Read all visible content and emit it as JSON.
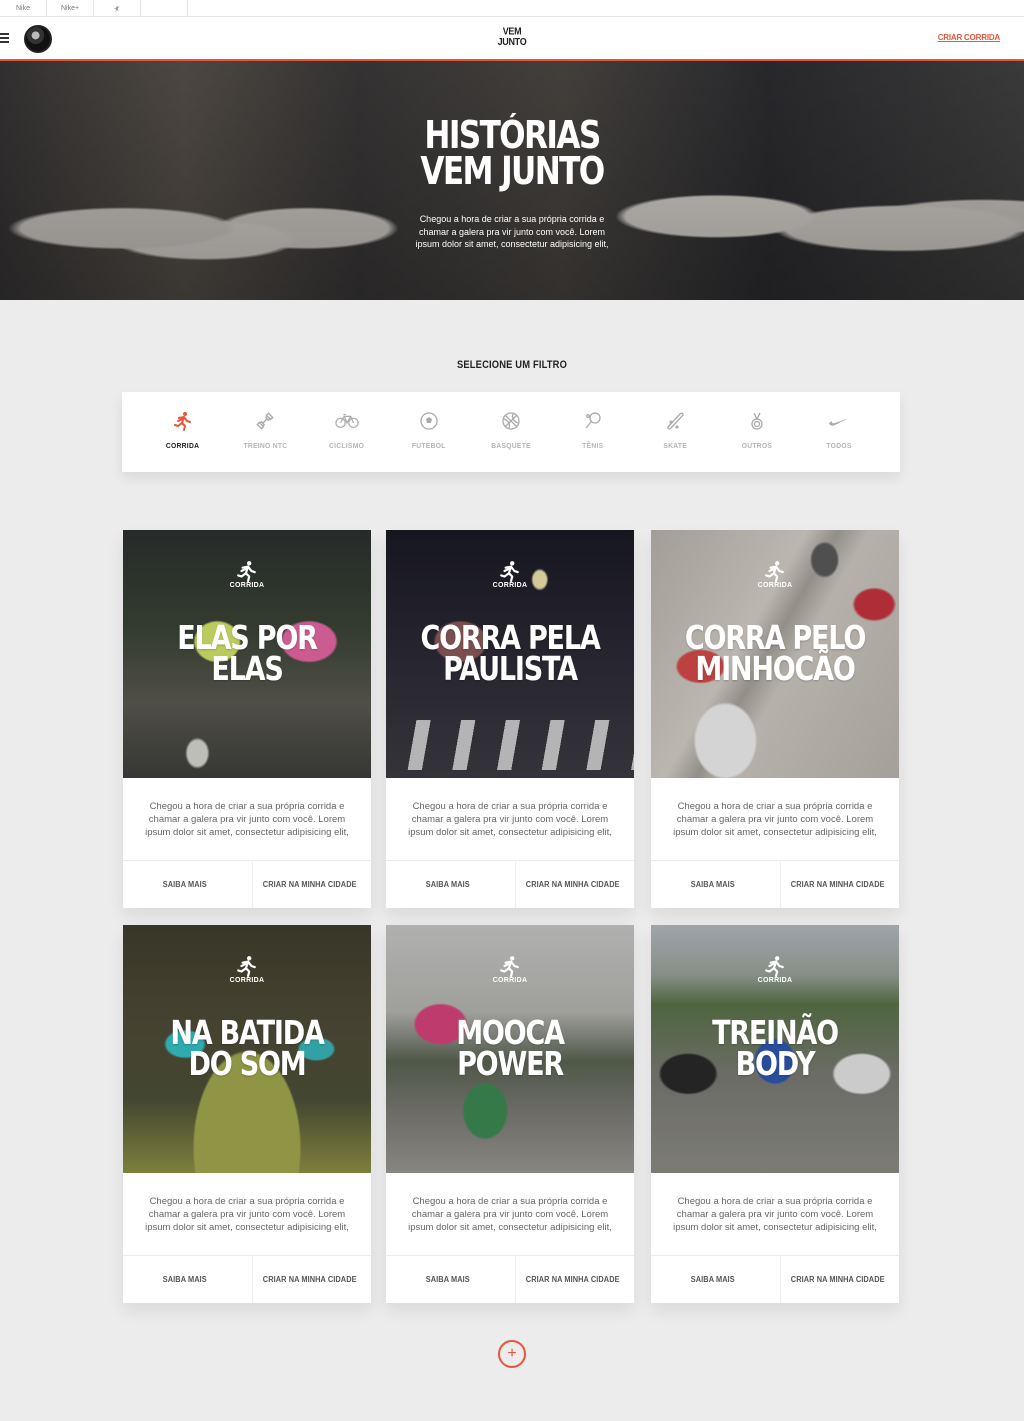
{
  "topbar": {
    "items": [
      "Nike",
      "Nike+",
      "Jordan"
    ]
  },
  "header": {
    "logo_line1": "VEM",
    "logo_line2": "JUNTO",
    "cta": "CRIAR CORRIDA"
  },
  "hero": {
    "title_line1": "HISTÓRIAS",
    "title_line2": "VEM JUNTO",
    "description": "Chegou a hora de criar a sua própria corrida e chamar a galera pra vir junto com você. Lorem ipsum dolor sit amet, consectetur adipisicing elit,"
  },
  "filter": {
    "heading": "SELECIONE UM FILTRO",
    "items": [
      {
        "label": "CORRIDA",
        "icon": "runner-icon",
        "active": true
      },
      {
        "label": "TREINO NTC",
        "icon": "dumbbell-icon",
        "active": false
      },
      {
        "label": "CICLISMO",
        "icon": "bicycle-icon",
        "active": false
      },
      {
        "label": "FUTEBOL",
        "icon": "soccer-ball-icon",
        "active": false
      },
      {
        "label": "BASQUETE",
        "icon": "basketball-icon",
        "active": false
      },
      {
        "label": "TÊNIS",
        "icon": "tennis-racket-icon",
        "active": false
      },
      {
        "label": "SKATE",
        "icon": "skateboard-icon",
        "active": false
      },
      {
        "label": "OUTROS",
        "icon": "medal-icon",
        "active": false
      },
      {
        "label": "TODOS",
        "icon": "swoosh-icon",
        "active": false
      }
    ]
  },
  "cards": [
    {
      "category": "CORRIDA",
      "title_line1": "ELAS POR",
      "title_line2": "ELAS",
      "description": "Chegou a hora de criar a sua própria corrida e chamar a galera pra vir junto com você. Lorem ipsum dolor sit amet, consectetur adipisicing elit,",
      "btn_more": "SAIBA MAIS",
      "btn_create": "CRIAR NA MINHA CIDADE"
    },
    {
      "category": "CORRIDA",
      "title_line1": "CORRA PELA",
      "title_line2": "PAULISTA",
      "description": "Chegou a hora de criar a sua própria corrida e chamar a galera pra vir junto com você. Lorem ipsum dolor sit amet, consectetur adipisicing elit,",
      "btn_more": "SAIBA MAIS",
      "btn_create": "CRIAR NA MINHA CIDADE"
    },
    {
      "category": "CORRIDA",
      "title_line1": "CORRA PELO",
      "title_line2": "MINHOCÃO",
      "description": "Chegou a hora de criar a sua própria corrida e chamar a galera pra vir junto com você. Lorem ipsum dolor sit amet, consectetur adipisicing elit,",
      "btn_more": "SAIBA MAIS",
      "btn_create": "CRIAR NA MINHA CIDADE"
    },
    {
      "category": "CORRIDA",
      "title_line1": "NA BATIDA",
      "title_line2": "DO SOM",
      "description": "Chegou a hora de criar a sua própria corrida e chamar a galera pra vir junto com você. Lorem ipsum dolor sit amet, consectetur adipisicing elit,",
      "btn_more": "SAIBA MAIS",
      "btn_create": "CRIAR NA MINHA CIDADE"
    },
    {
      "category": "CORRIDA",
      "title_line1": "MOOCA",
      "title_line2": "POWER",
      "description": "Chegou a hora de criar a sua própria corrida e chamar a galera pra vir junto com você. Lorem ipsum dolor sit amet, consectetur adipisicing elit,",
      "btn_more": "SAIBA MAIS",
      "btn_create": "CRIAR NA MINHA CIDADE"
    },
    {
      "category": "CORRIDA",
      "title_line1": "TREINÃO",
      "title_line2": "BODY",
      "description": "Chegou a hora de criar a sua própria corrida e chamar a galera pra vir junto com você. Lorem ipsum dolor sit amet, consectetur adipisicing elit,",
      "btn_more": "SAIBA MAIS",
      "btn_create": "CRIAR NA MINHA CIDADE"
    }
  ],
  "load_more": {
    "symbol": "+"
  },
  "colors": {
    "accent": "#e8553b",
    "background": "#ececec"
  }
}
